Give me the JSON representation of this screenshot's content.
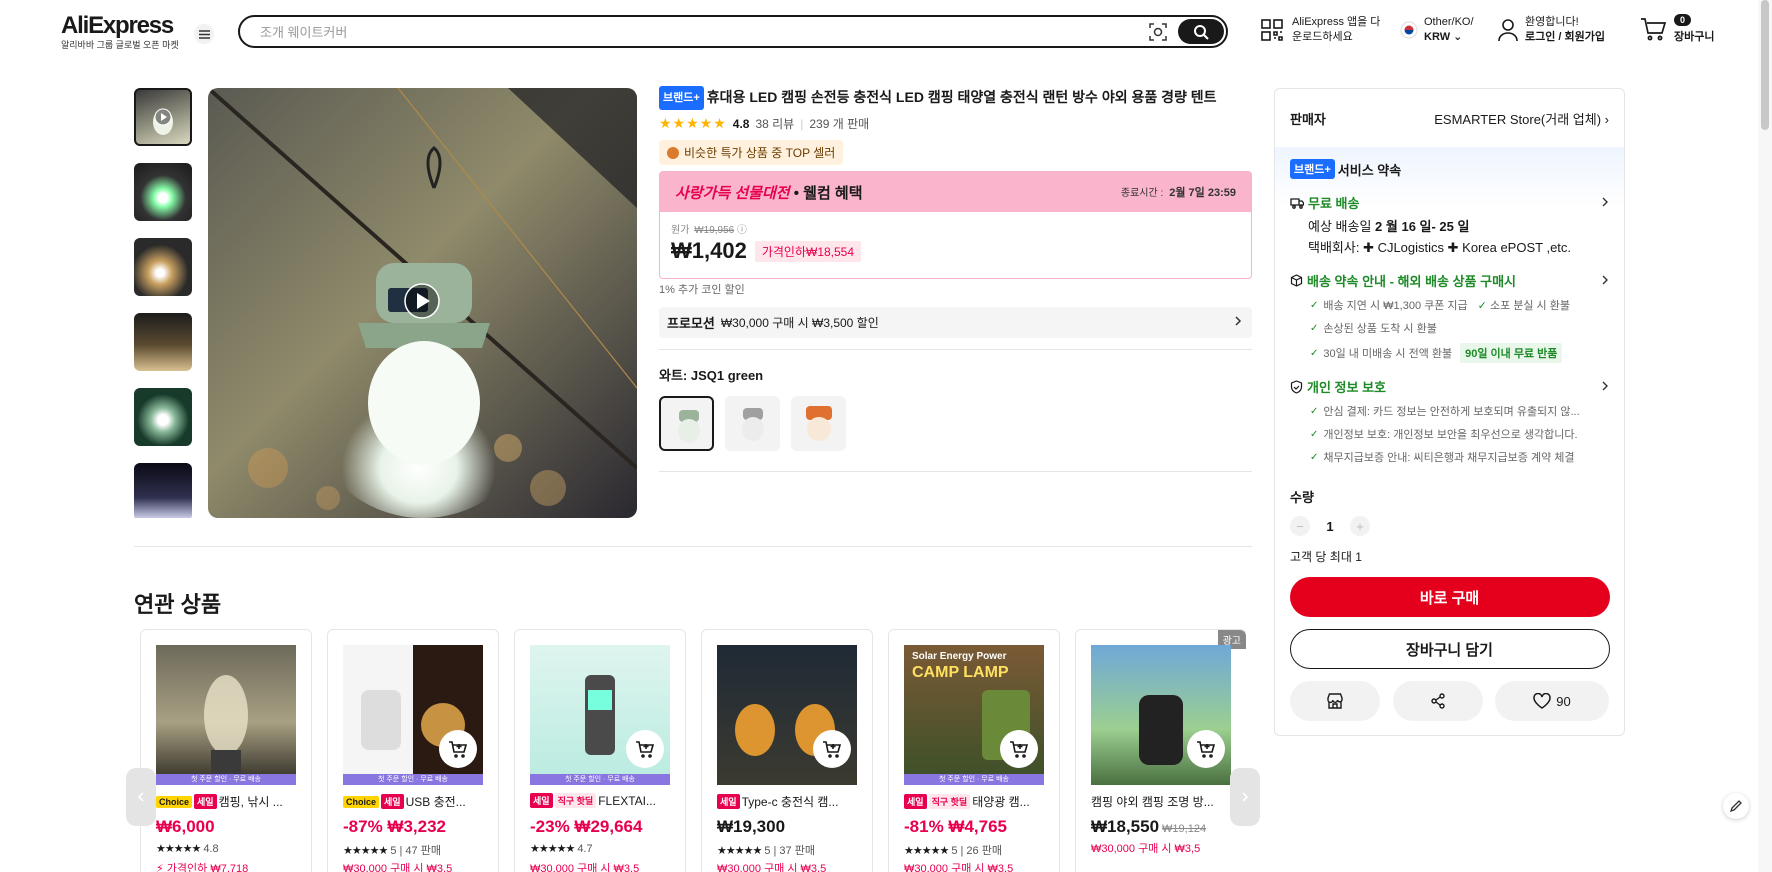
{
  "header": {
    "logo": "AliExpress",
    "logo_sub": "알리바바 그룹 글로벌 오픈 마켓",
    "search_placeholder": "조개 웨이트커버",
    "app_line1": "AliExpress 앱을 다",
    "app_line2": "운로드하세요",
    "region": "Other/KO/",
    "currency": "KRW",
    "greeting": "환영합니다!",
    "login": "로그인 / 회원가입",
    "cart_count": "0",
    "cart_label": "장바구니"
  },
  "product": {
    "brand_badge": "브랜드+",
    "title": "휴대용 LED 캠핑 손전등 충전식 LED 캠핑 태양열 충전식 랜턴 방수 야외 용품 경량 텐트",
    "rating": "4.8",
    "reviews": "38 리뷰",
    "sold": "239 개 판매",
    "top_seller": "비슷한 특가 상품 중 TOP 셀러",
    "deal_title": "사랑가득 선물대전",
    "deal_sub": "• 웰컴 혜택",
    "deal_end_label": "종료시간 :",
    "deal_end": "2월 7일 23:59",
    "orig_label": "원가",
    "orig_price": "₩19,956",
    "price": "₩1,402",
    "discount": "가격인하₩18,554",
    "coin": "1% 추가 코인 할인",
    "promo_label": "프로모션",
    "promo_text": "₩30,000 구매 시 ₩3,500 할인",
    "color_label": "와트: JSQ1 green"
  },
  "related": {
    "heading": "연관 상품",
    "band": "첫 주문 할인 · 무료 배송",
    "ad": "광고",
    "items": [
      {
        "tag1": "Choice",
        "tag2": "세일",
        "title": "캠핑, 낚시 ...",
        "price": "₩6,000",
        "rating": "4.8",
        "meta": "",
        "coupon": "⚡ 가격인하 ₩7,718"
      },
      {
        "tag1": "Choice",
        "tag2": "세일",
        "title": "USB 충전...",
        "price": "-87% ₩3,232",
        "rating": "5",
        "meta": "47 판매",
        "coupon": "₩30,000 구매 시 ₩3,5"
      },
      {
        "tag1": "세일",
        "tag2": "직구 핫딜",
        "title": "FLEXTAI...",
        "price": "-23% ₩29,664",
        "rating": "4.7",
        "meta": "",
        "coupon": "₩30,000 구매 시 ₩3,5"
      },
      {
        "tag1": "세일",
        "tag2": "",
        "title": "Type-c 충전식 캠...",
        "price": "₩19,300",
        "rating": "5",
        "meta": "37 판매",
        "coupon": "₩30,000 구매 시 ₩3,5"
      },
      {
        "tag1": "세일",
        "tag2": "직구 핫딜",
        "title": "태양광 캠...",
        "price": "-81% ₩4,765",
        "rating": "5",
        "meta": "26 판매",
        "coupon": "₩30,000 구매 시 ₩3,5"
      },
      {
        "tag1": "",
        "tag2": "",
        "title": "캠핑 야외 캠핑 조명 방...",
        "price": "₩18,550",
        "price_orig": "₩19,124",
        "rating": "",
        "meta": "",
        "coupon": "₩30,000 구매 시 ₩3,5"
      }
    ]
  },
  "panel": {
    "seller_label": "판매자",
    "seller_name": "ESMARTER Store(거래 업체)",
    "promise_badge": "브랜드+",
    "promise_title": "서비스 약속",
    "free_ship": "무료 배송",
    "eta_prefix": "예상 배송일",
    "eta": "2 월 16 일- 25 일",
    "courier": "택배회사: ✚ CJLogistics ✚ Korea ePOST ,etc.",
    "ship_guide": "배송 약속 안내 - 해외 배송 상품 구매시",
    "ship_checks": [
      "배송 지연 시 ₩1,300 쿠폰 지급",
      "소포 분실 시 환불",
      "손상된 상품 도착 시 환불",
      "30일 내 미배송 시 전액 환불"
    ],
    "return_badge": "90일 이내 무료 반품",
    "privacy": "개인 정보 보호",
    "privacy_checks": [
      "안심 결제: 카드 정보는 안전하게 보호되며 유출되지 않...",
      "개인정보 보호: 개인정보 보안을 최우선으로 생각합니다.",
      "채무지급보증 안내: 씨티은행과 채무지급보증 계약 체결"
    ],
    "qty_label": "수량",
    "qty": "1",
    "max_per": "고객 당 최대 1",
    "buy_now": "바로 구매",
    "add_cart": "장바구니 담기",
    "wish_count": "90"
  }
}
